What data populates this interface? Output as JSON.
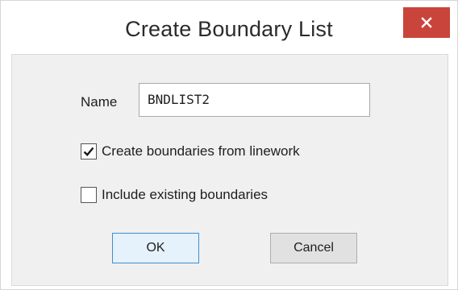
{
  "dialog": {
    "title": "Create Boundary List",
    "close_icon": "close-icon",
    "accent_close": "#c9443a"
  },
  "form": {
    "name_label": "Name",
    "name_value": "BNDLIST2",
    "checkboxes": [
      {
        "label": "Create boundaries from linework",
        "checked": true
      },
      {
        "label": "Include existing boundaries",
        "checked": false
      }
    ]
  },
  "buttons": {
    "ok_label": "OK",
    "cancel_label": "Cancel"
  }
}
